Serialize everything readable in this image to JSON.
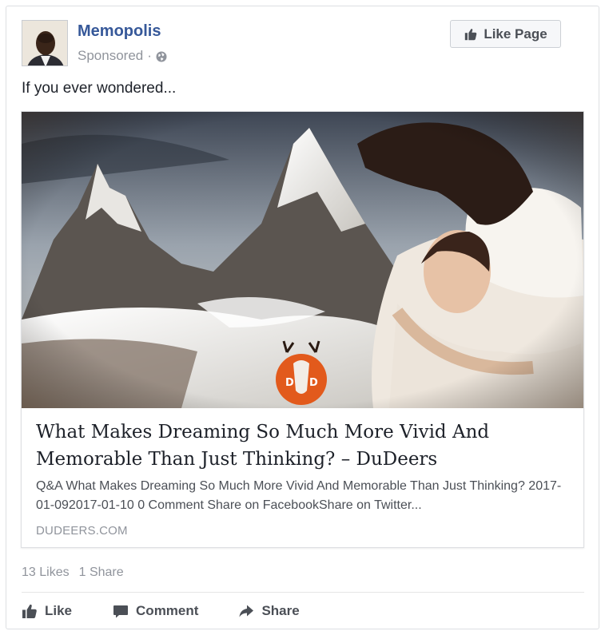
{
  "post": {
    "page_name": "Memopolis",
    "sponsored": "Sponsored",
    "separator": "·",
    "like_page_label": "Like Page",
    "text": "If you ever wondered...",
    "link": {
      "title": "What Makes Dreaming So Much More Vivid And Memorable Than Just Thinking? – DuDeers",
      "description": "Q&A What Makes Dreaming So Much More Vivid And Memorable Than Just Thinking? 2017-01-092017-01-10 0 Comment Share on FacebookShare on Twitter...",
      "domain": "DUDEERS.COM"
    },
    "stats": {
      "likes": "13 Likes",
      "shares": "1 Share"
    },
    "actions": {
      "like": "Like",
      "comment": "Comment",
      "share": "Share"
    }
  },
  "colors": {
    "page_name": "#365899",
    "secondary_text": "#90949c",
    "action_text": "#4b4f56"
  },
  "icons": [
    "globe-icon",
    "thumbs-up-icon",
    "comment-icon",
    "share-arrow-icon",
    "deer-logo"
  ]
}
